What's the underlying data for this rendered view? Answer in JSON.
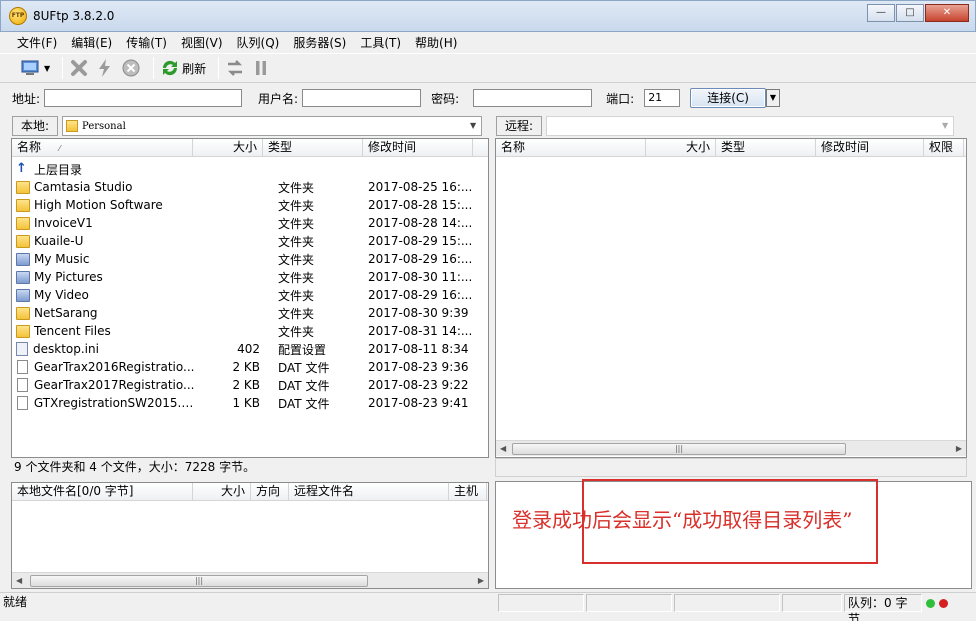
{
  "window": {
    "title": "8UFtp 3.8.2.0",
    "app_icon_text": "FTP"
  },
  "menu": [
    "文件(F)",
    "编辑(E)",
    "传输(T)",
    "视图(V)",
    "队列(Q)",
    "服务器(S)",
    "工具(T)",
    "帮助(H)"
  ],
  "toolbar": {
    "refresh_label": "刷新"
  },
  "connect": {
    "address_label": "地址:",
    "address_value": "",
    "user_label": "用户名:",
    "user_value": "",
    "password_label": "密码:",
    "password_value": "",
    "port_label": "端口:",
    "port_value": "21",
    "connect_label": "连接(C)"
  },
  "local": {
    "label": "本地:",
    "path": "Personal",
    "columns": [
      "名称",
      "大小",
      "类型",
      "修改时间"
    ],
    "rows": [
      {
        "name": "上层目录",
        "size": "",
        "type": "",
        "modified": "",
        "icon": "up-icon"
      },
      {
        "name": "Camtasia Studio",
        "size": "",
        "type": "文件夹",
        "modified": "2017-08-25 16:...",
        "icon": "folder-icon"
      },
      {
        "name": "High Motion Software",
        "size": "",
        "type": "文件夹",
        "modified": "2017-08-28 15:...",
        "icon": "folder-icon"
      },
      {
        "name": "InvoiceV1",
        "size": "",
        "type": "文件夹",
        "modified": "2017-08-28 14:...",
        "icon": "folder-icon"
      },
      {
        "name": "Kuaile-U",
        "size": "",
        "type": "文件夹",
        "modified": "2017-08-29 15:...",
        "icon": "folder-icon"
      },
      {
        "name": "My Music",
        "size": "",
        "type": "文件夹",
        "modified": "2017-08-29 16:...",
        "icon": "music-folder-icon"
      },
      {
        "name": "My Pictures",
        "size": "",
        "type": "文件夹",
        "modified": "2017-08-30 11:...",
        "icon": "pictures-folder-icon"
      },
      {
        "name": "My Video",
        "size": "",
        "type": "文件夹",
        "modified": "2017-08-29 16:...",
        "icon": "video-folder-icon"
      },
      {
        "name": "NetSarang",
        "size": "",
        "type": "文件夹",
        "modified": "2017-08-30 9:39",
        "icon": "folder-icon"
      },
      {
        "name": "Tencent Files",
        "size": "",
        "type": "文件夹",
        "modified": "2017-08-31 14:...",
        "icon": "folder-icon"
      },
      {
        "name": "desktop.ini",
        "size": "402",
        "type": "配置设置",
        "modified": "2017-08-11 8:34",
        "icon": "ini-file-icon"
      },
      {
        "name": "GearTrax2016Registratio...",
        "size": "2 KB",
        "type": "DAT 文件",
        "modified": "2017-08-23 9:36",
        "icon": "file-icon"
      },
      {
        "name": "GearTrax2017Registratio...",
        "size": "2 KB",
        "type": "DAT 文件",
        "modified": "2017-08-23 9:22",
        "icon": "file-icon"
      },
      {
        "name": "GTXregistrationSW2015.d...",
        "size": "1 KB",
        "type": "DAT 文件",
        "modified": "2017-08-23 9:41",
        "icon": "file-icon"
      }
    ],
    "summary": "9 个文件夹和 4 个文件，大小：7228 字节。"
  },
  "remote": {
    "label": "远程:",
    "path": "",
    "columns": [
      "名称",
      "大小",
      "类型",
      "修改时间",
      "权限"
    ]
  },
  "queue": {
    "columns": [
      "本地文件名[0/0 字节]",
      "大小",
      "方向",
      "远程文件名",
      "主机"
    ]
  },
  "log": {
    "annotation": "登录成功后会显示“成功取得目录列表”"
  },
  "statusbar": {
    "ready": "就绪",
    "queue": "队列：0 字节",
    "colors": {
      "green": "#2fbf3a",
      "red": "#d42020"
    }
  }
}
